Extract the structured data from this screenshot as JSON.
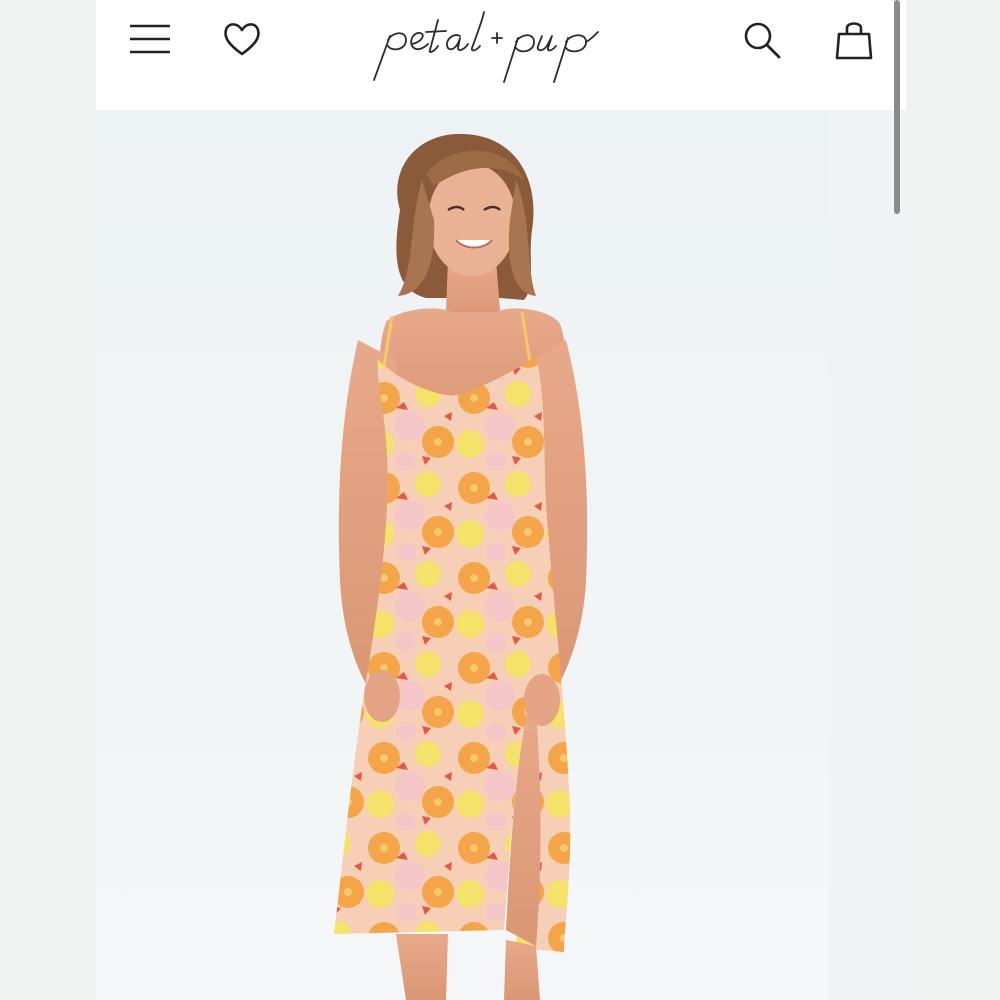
{
  "brand": {
    "logo_text": "petal + pup"
  },
  "header": {
    "icons": [
      "menu-icon",
      "heart-icon",
      "search-icon",
      "shopping-bag-icon"
    ]
  },
  "product": {
    "image": "model-in-floral-midi-slip-dress",
    "colors": {
      "dress_orange": "#f4a54a",
      "dress_yellow": "#f4e26a",
      "dress_pink": "#f4c6c8",
      "dress_red": "#e6574a"
    }
  }
}
